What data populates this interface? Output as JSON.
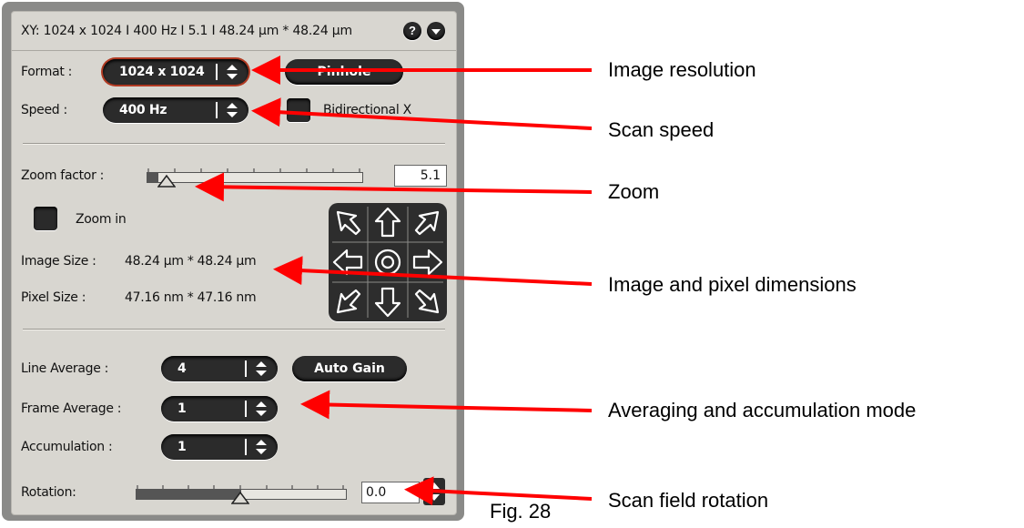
{
  "panel": {
    "header_text": "XY:  1024 x 1024 I 400 Hz I 5.1 I 48.24 µm * 48.24 µm",
    "help_icon": "?",
    "format": {
      "label": "Format :",
      "value": "1024 x 1024"
    },
    "pinhole_label": "Pinhole",
    "speed": {
      "label": "Speed :",
      "value": "400 Hz"
    },
    "bidirectional_label": "Bidirectional X",
    "zoom": {
      "label": "Zoom factor :",
      "value": "5.1",
      "level_fraction": 0.05
    },
    "zoom_in_label": "Zoom in",
    "image_size": {
      "label": "Image Size :",
      "value": "48.24 µm * 48.24 µm"
    },
    "pixel_size": {
      "label": "Pixel Size :",
      "value": "47.16 nm * 47.16 nm"
    },
    "line_average": {
      "label": "Line Average :",
      "value": "4"
    },
    "auto_gain_label": "Auto Gain",
    "frame_average": {
      "label": "Frame Average :",
      "value": "1"
    },
    "accumulation": {
      "label": "Accumulation :",
      "value": "1"
    },
    "rotation": {
      "label": "Rotation:",
      "value": "0.0",
      "level_fraction": 0.5
    }
  },
  "annotations": {
    "image_resolution": "Image resolution",
    "scan_speed": "Scan speed",
    "zoom": "Zoom",
    "image_pixel_dimensions": "Image and pixel dimensions",
    "averaging": "Averaging and accumulation mode",
    "rotation": "Scan field rotation",
    "figure_caption": "Fig. 28"
  },
  "colors": {
    "arrow": "#ff0000",
    "panel_bg": "#d8d6d0",
    "control_dark": "#2b2b2b",
    "active_outline": "#b03a22"
  },
  "icons": [
    "help-icon",
    "collapse-icon",
    "dropdown-arrows-icon",
    "pan-arrow-icon",
    "center-target-icon"
  ]
}
